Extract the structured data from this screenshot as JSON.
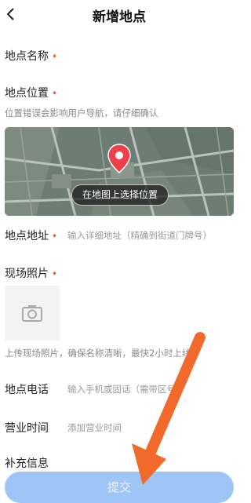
{
  "header": {
    "title": "新增地点",
    "back_icon": "chevron-left-icon"
  },
  "form": {
    "name": {
      "label": "地点名称",
      "required_mark": "•"
    },
    "location": {
      "label": "地点位置",
      "required_mark": "•",
      "hint": "位置错误会影响用户导航，请仔细确认",
      "map_button": "在地图上选择位置",
      "pin_icon": "map-pin-icon"
    },
    "address": {
      "label": "地点地址",
      "required_mark": "•",
      "placeholder": "输入详细地址（精确到街道门牌号）"
    },
    "photo": {
      "label": "现场照片",
      "required_mark": "•",
      "upload_icon": "camera-icon",
      "hint": "上传现场照片，确保名称清晰，最快2小时上线"
    },
    "phone": {
      "label": "地点电话",
      "placeholder": "输入手机或固话（需带区号）"
    },
    "hours": {
      "label": "营业时间",
      "placeholder": "添加营业时间"
    },
    "extra": {
      "label": "补充信息"
    }
  },
  "submit": {
    "label": "提交"
  },
  "colors": {
    "accent": "#f05a28",
    "submit_bg": "#9fc5f6",
    "annotation_arrow": "#f26a2b"
  }
}
